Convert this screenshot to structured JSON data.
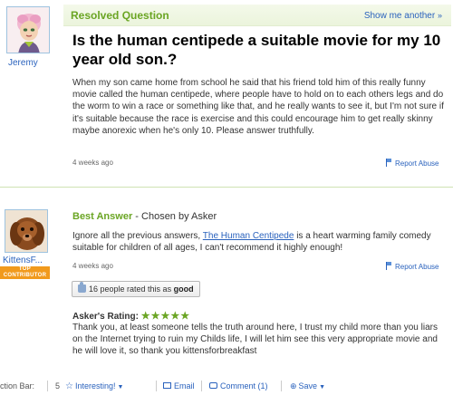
{
  "question": {
    "status": "Resolved Question",
    "show_another": "Show me another",
    "show_another_arrow": "»",
    "asker": "Jeremy",
    "title": "Is the human centipede a suitable movie for my 10 year old son.?",
    "body": "When my son came home from school he said that his friend told him of this really funny movie called the human centipede, where people have to hold on to each others legs and do the worm to win a race or something like that, and he really wants to see it, but I'm not sure if it's suitable because the race is exercise and this could encourage him to get really skinny maybe anorexic when he's only 10. Please answer truthfully.",
    "time": "4 weeks ago",
    "report": "Report Abuse"
  },
  "best_answer": {
    "label": "Best Answer",
    "chosen_by": " - Chosen by Asker",
    "answerer": "KittensF...",
    "badge": "TOP CONTRIBUTOR",
    "body_pre": "Ignore all the previous answers, ",
    "body_link": "The Human Centipede",
    "body_post": " is a heart warming family comedy suitable for children of all ages, I can't recommend it highly enough!",
    "time": "4 weeks ago",
    "report": "Report Abuse",
    "rated_prefix": "16 people rated this as ",
    "rated_value": "good",
    "asker_rating_label": "Asker's Rating:",
    "stars": "★★★★★",
    "rating_comment": "Thank you, at least someone tells the truth around here, I trust my child more than you liars on the Internet trying to ruin my Childs life, I will let him see this very appropriate movie and he will love it, so thank you kittensforbreakfast"
  },
  "action_bar": {
    "label": "ction Bar:",
    "count": "5",
    "interesting": "Interesting!",
    "email": "Email",
    "comment": "Comment (1)",
    "save": "Save"
  },
  "colors": {
    "accent_green": "#6aa523",
    "link_blue": "#2a62bd",
    "badge_orange": "#f19a1d"
  },
  "icons": [
    "profile-avatar",
    "puppy-avatar",
    "flag-icon",
    "thumbs-up-icon",
    "star-icon",
    "mail-icon",
    "comment-icon",
    "save-icon",
    "chevron-down-icon"
  ]
}
